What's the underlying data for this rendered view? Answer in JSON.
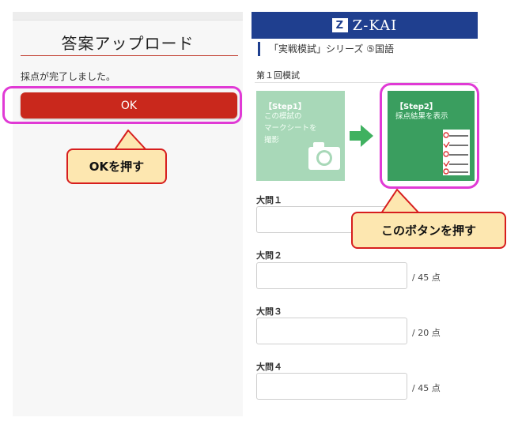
{
  "left": {
    "title": "答案アップロード",
    "message": "採点が完了しました。",
    "ok_label": "OK"
  },
  "callouts": {
    "press_ok": "OKを押す",
    "press_button": "このボタンを押す"
  },
  "right": {
    "brand": "Z-KAI",
    "series_title": "「実戦模試」シリーズ ⑤国語",
    "exam_label": "第１回模試",
    "step1": {
      "title": "【Step1】",
      "body": "この模試の\nマークシートを\n撮影"
    },
    "step2": {
      "title": "【Step2】",
      "body": "採点結果を表示"
    },
    "sections": [
      {
        "label": "大問１",
        "max": ""
      },
      {
        "label": "大問２",
        "max": "/ 45 点"
      },
      {
        "label": "大問３",
        "max": "/ 20 点"
      },
      {
        "label": "大問４",
        "max": "/ 45 点"
      }
    ]
  },
  "colors": {
    "ok_red": "#c9281c",
    "highlight_magenta": "#e03ad5",
    "callout_fill": "#fde7b0",
    "brand_blue": "#1f3f8f",
    "step1_green": "#a8d8b8",
    "step2_green": "#3a9e5f"
  },
  "icons": [
    "camera-icon",
    "arrow-right-icon",
    "checklist-icon"
  ]
}
